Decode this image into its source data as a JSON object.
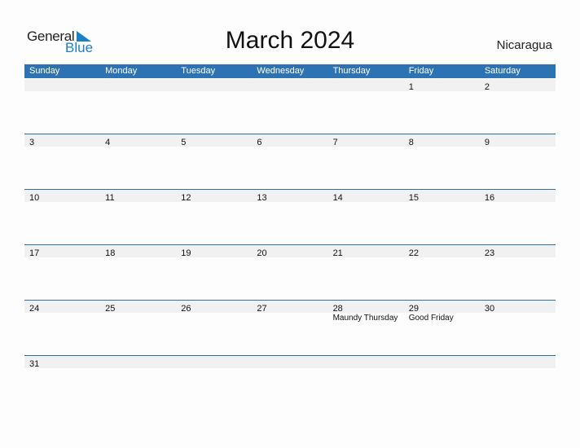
{
  "logo": {
    "general": "General",
    "blue": "Blue",
    "accent_color": "#1d7fc4"
  },
  "title": "March 2024",
  "country": "Nicaragua",
  "header_color": "#2d72b3",
  "weekdays": [
    "Sunday",
    "Monday",
    "Tuesday",
    "Wednesday",
    "Thursday",
    "Friday",
    "Saturday"
  ],
  "weeks": [
    [
      {
        "day": ""
      },
      {
        "day": ""
      },
      {
        "day": ""
      },
      {
        "day": ""
      },
      {
        "day": ""
      },
      {
        "day": "1"
      },
      {
        "day": "2"
      }
    ],
    [
      {
        "day": "3"
      },
      {
        "day": "4"
      },
      {
        "day": "5"
      },
      {
        "day": "6"
      },
      {
        "day": "7"
      },
      {
        "day": "8"
      },
      {
        "day": "9"
      }
    ],
    [
      {
        "day": "10"
      },
      {
        "day": "11"
      },
      {
        "day": "12"
      },
      {
        "day": "13"
      },
      {
        "day": "14"
      },
      {
        "day": "15"
      },
      {
        "day": "16"
      }
    ],
    [
      {
        "day": "17"
      },
      {
        "day": "18"
      },
      {
        "day": "19"
      },
      {
        "day": "20"
      },
      {
        "day": "21"
      },
      {
        "day": "22"
      },
      {
        "day": "23"
      }
    ],
    [
      {
        "day": "24"
      },
      {
        "day": "25"
      },
      {
        "day": "26"
      },
      {
        "day": "27"
      },
      {
        "day": "28",
        "holiday": "Maundy Thursday"
      },
      {
        "day": "29",
        "holiday": "Good Friday"
      },
      {
        "day": "30"
      }
    ],
    [
      {
        "day": "31"
      },
      {
        "day": ""
      },
      {
        "day": ""
      },
      {
        "day": ""
      },
      {
        "day": ""
      },
      {
        "day": ""
      },
      {
        "day": ""
      }
    ]
  ]
}
